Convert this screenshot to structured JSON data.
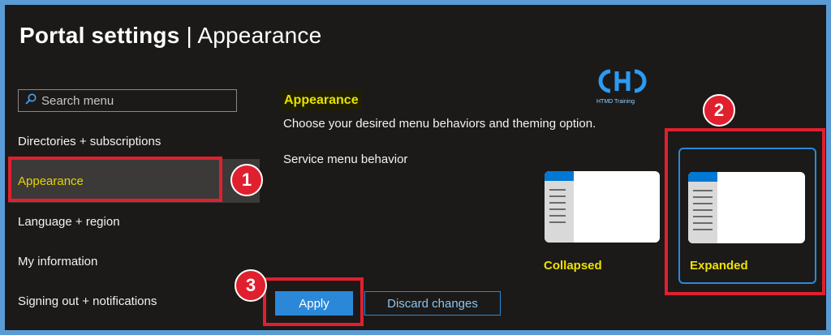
{
  "header": {
    "title_part1": "Portal settings",
    "separator": "|",
    "title_part2": "Appearance"
  },
  "search": {
    "placeholder": "Search menu"
  },
  "sidebar": {
    "items": [
      {
        "label": "Directories + subscriptions"
      },
      {
        "label": "Appearance"
      },
      {
        "label": "Language + region"
      },
      {
        "label": "My information"
      },
      {
        "label": "Signing out + notifications"
      }
    ]
  },
  "main": {
    "section_title": "Appearance",
    "description": "Choose your desired menu behaviors and theming option.",
    "service_menu_label": "Service menu behavior",
    "options": [
      {
        "label": "Collapsed"
      },
      {
        "label": "Expanded"
      }
    ],
    "apply_label": "Apply",
    "discard_label": "Discard changes"
  },
  "annotations": {
    "badge1": "1",
    "badge2": "2",
    "badge3": "3"
  },
  "watermark": {
    "text": "HTMD Training"
  },
  "colors": {
    "accent": "#2b88d8",
    "highlight_yellow": "#fff200",
    "annotation_red": "#e0202e",
    "background": "#1b1a19"
  }
}
